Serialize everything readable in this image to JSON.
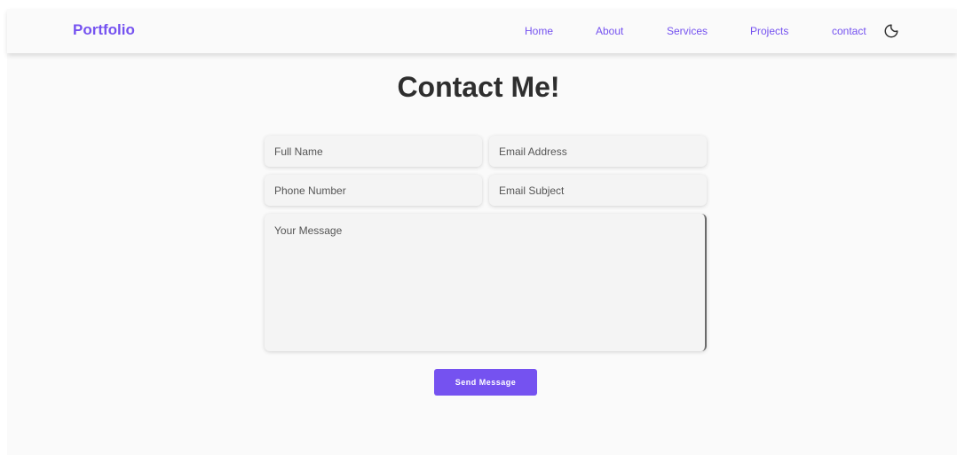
{
  "header": {
    "brand": "Portfolio",
    "nav": {
      "home": "Home",
      "about": "About",
      "services": "Services",
      "projects": "Projects",
      "contact": "contact"
    },
    "theme_toggle_icon": "moon-icon"
  },
  "main": {
    "title": "Contact Me!",
    "form": {
      "full_name": {
        "placeholder": "Full Name",
        "value": ""
      },
      "email_address": {
        "placeholder": "Email Address",
        "value": ""
      },
      "phone_number": {
        "placeholder": "Phone Number",
        "value": ""
      },
      "email_subject": {
        "placeholder": "Email Subject",
        "value": ""
      },
      "message": {
        "placeholder": "Your Message",
        "value": ""
      },
      "submit_label": "Send Message"
    }
  },
  "colors": {
    "accent": "#7552f0",
    "background": "#fafafa",
    "field_background": "#f4f4f4",
    "heading": "#2e2e2e"
  }
}
